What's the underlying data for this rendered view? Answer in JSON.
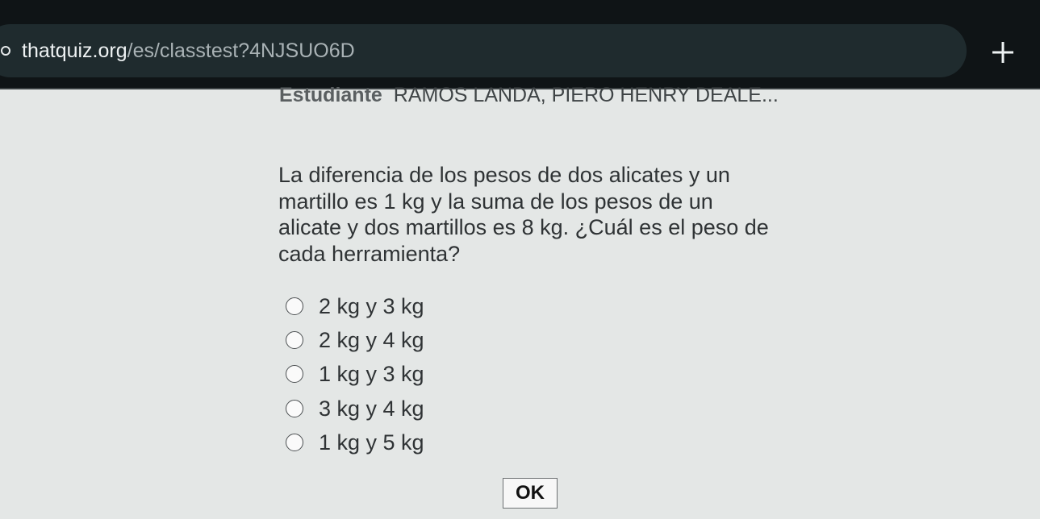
{
  "browser": {
    "url_domain": "thatquiz.org",
    "url_path": "/es/classtest?4NJSUO6D",
    "site_icon": "tune-icon",
    "new_tab_icon": "plus-icon"
  },
  "student": {
    "label": "Estudiante",
    "name": "RAMOS LANDA, PIERO HENRY DEALE..."
  },
  "question": {
    "text": "La diferencia de los pesos de dos alicates y un martillo es 1 kg y la suma de los pesos de un alicate y dos martillos es 8 kg. ¿Cuál es el peso de cada herramienta?"
  },
  "options": [
    {
      "label": "2 kg y 3 kg"
    },
    {
      "label": "2 kg y 4 kg"
    },
    {
      "label": "1 kg y 3 kg"
    },
    {
      "label": "3 kg y 4 kg"
    },
    {
      "label": "1 kg y 5 kg"
    }
  ],
  "ok_button": {
    "label": "OK"
  },
  "colors": {
    "page_background": "#e4e7e6",
    "browser_bar": "#0f1416",
    "url_field": "#1f2b2e"
  }
}
